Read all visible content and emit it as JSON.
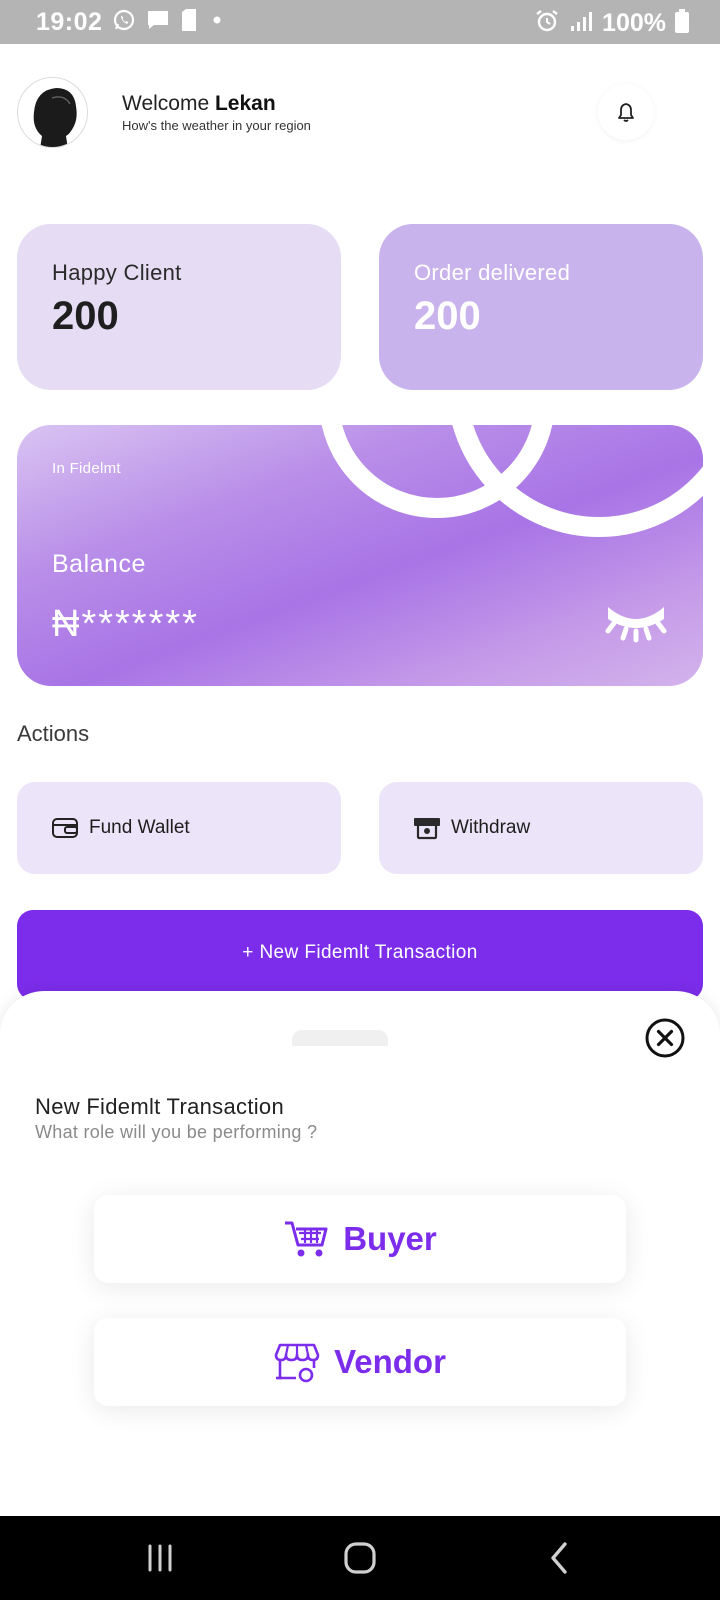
{
  "status_bar": {
    "time": "19:02",
    "battery": "100%",
    "icons": [
      "whatsapp-icon",
      "message-icon",
      "sd-card-icon",
      "dot-icon",
      "alarm-icon",
      "signal-icon",
      "battery-icon"
    ]
  },
  "header": {
    "welcome_prefix": "Welcome",
    "user_name": "Lekan",
    "subtitle": "How's the weather in your region",
    "notification_icon": "bell-icon"
  },
  "stats": [
    {
      "label": "Happy Client",
      "value": "200"
    },
    {
      "label": "Order delivered",
      "value": "200"
    }
  ],
  "balance": {
    "caption": "In Fidelmt",
    "label": "Balance",
    "masked_value": "₦*******",
    "visibility_icon": "eye-closed-icon"
  },
  "actions": {
    "title": "Actions",
    "fund_wallet": "Fund Wallet",
    "withdraw": "Withdraw",
    "new_transaction": "+ New Fidemlt Transaction"
  },
  "sheet": {
    "title": "New Fidemlt Transaction",
    "subtitle": "What role will you be performing ?",
    "buyer": "Buyer",
    "vendor": "Vendor"
  },
  "colors": {
    "primary": "#7c2deb",
    "card_light": "#e6dcf4",
    "card_medium": "#c9b3ec",
    "action_bg": "#ece4f8"
  }
}
